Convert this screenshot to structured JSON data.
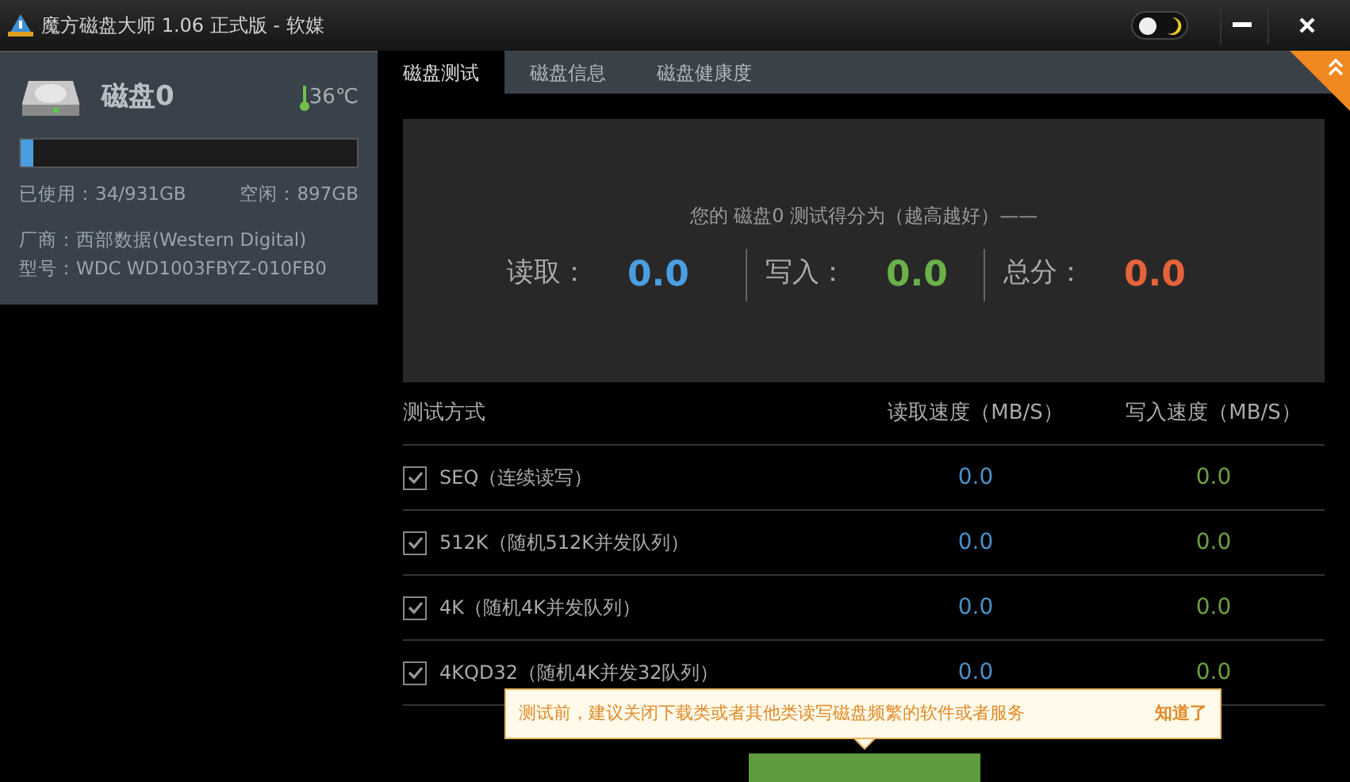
{
  "window": {
    "title": "魔方磁盘大师 1.06 正式版 - 软媒"
  },
  "theme_toggle": {
    "on": false
  },
  "disk": {
    "name": "磁盘0",
    "temperature": "36℃",
    "level": 0.037,
    "used": "已使用：34/931GB",
    "free": "空闲：897GB",
    "vendor": "厂商：西部数据(Western Digital)",
    "model": "型号：WDC WD1003FBYZ-010FB0"
  },
  "tabs": [
    {
      "label": "磁盘测试",
      "selected": true
    },
    {
      "label": "磁盘信息",
      "selected": false
    },
    {
      "label": "磁盘健康度",
      "selected": false
    }
  ],
  "score": {
    "caption": "您的 磁盘0 测试得分为（越高越好）——",
    "items": [
      {
        "label": "读取：",
        "value": "0.0",
        "color": "#4a9ee0"
      },
      {
        "label": "写入：",
        "value": "0.0",
        "color": "#6ab04a"
      },
      {
        "label": "总分：",
        "value": "0.0",
        "color": "#e5633b"
      }
    ]
  },
  "table": {
    "columns": [
      "测试方式",
      "读取速度（MB/S）",
      "写入速度（MB/S）"
    ],
    "rows": [
      {
        "checked": true,
        "name": "SEQ（连续读写）",
        "read": "0.0",
        "write": "0.0"
      },
      {
        "checked": true,
        "name": "512K（随机512K并发队列）",
        "read": "0.0",
        "write": "0.0"
      },
      {
        "checked": true,
        "name": "4K（随机4K并发队列）",
        "read": "0.0",
        "write": "0.0"
      },
      {
        "checked": true,
        "name": "4KQD32（随机4K并发32队列）",
        "read": "0.0",
        "write": "0.0"
      }
    ]
  },
  "tip": {
    "message": "测试前，建议关闭下载类或者其他类读写磁盘频繁的软件或者服务",
    "action": "知道了"
  }
}
